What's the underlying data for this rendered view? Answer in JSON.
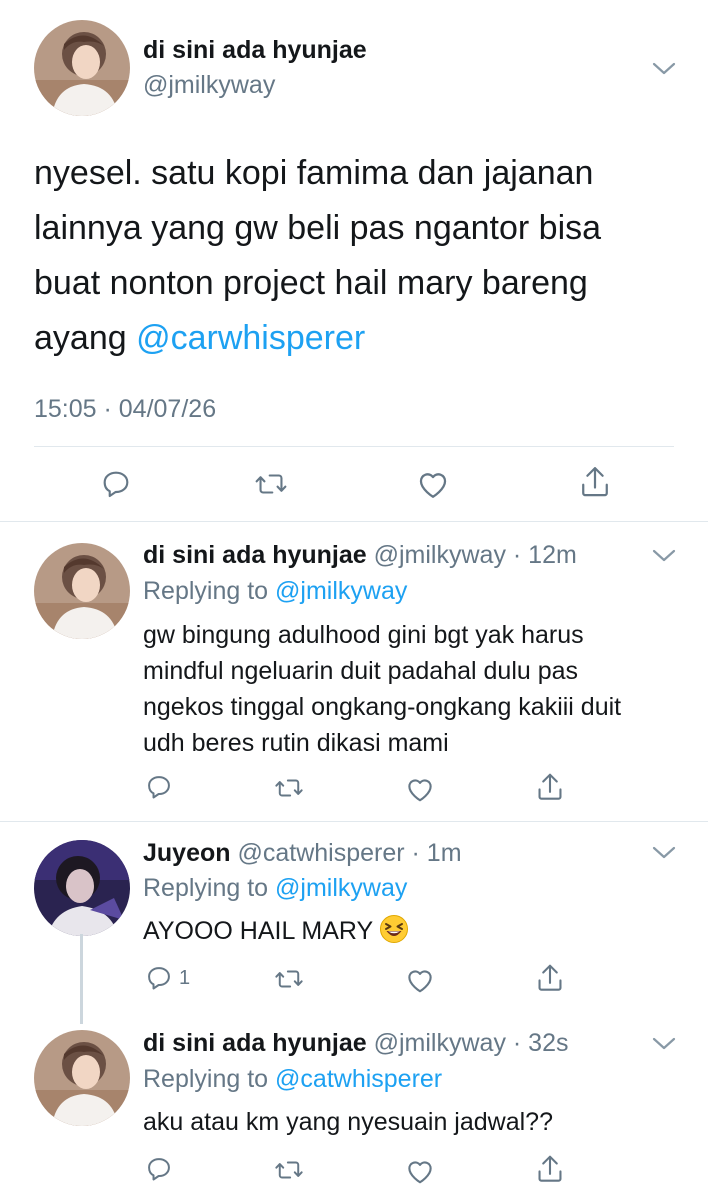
{
  "main_tweet": {
    "display_name": "di sini ada hyunjae",
    "handle": "@jmilkyway",
    "text": "nyesel. satu kopi famima dan jajanan lainnya yang gw beli pas ngantor bisa buat nonton project hail mary bareng ayang ",
    "mention": "@carwhisperer",
    "timestamp": "15:05 · 04/07/26",
    "avatar_icon": "profile-photo-hyunjae"
  },
  "replies": [
    {
      "display_name": "di sini ada hyunjae",
      "meta": "@jmilkyway · 12m",
      "replying_label": "Replying to ",
      "replying_to": "@jmilkyway",
      "text": "gw bingung adulhood gini bgt yak harus mindful ngeluarin duit padahal dulu pas ngekos tinggal ongkang-ongkang kakiii duit udh beres rutin dikasi mami",
      "reply_count": ""
    },
    {
      "display_name": "Juyeon",
      "meta": "@catwhisperer · 1m",
      "replying_label": "Replying to ",
      "replying_to": "@jmilkyway",
      "text": "AYOOO HAIL MARY",
      "emoji": "grinning-squinting-face",
      "reply_count": "1"
    },
    {
      "display_name": "di sini ada hyunjae",
      "meta": "@jmilkyway · 32s",
      "replying_label": "Replying to ",
      "replying_to": "@catwhisperer",
      "text": "aku atau km yang nyesuain jadwal??",
      "reply_count": ""
    }
  ],
  "icons": [
    "reply-icon",
    "retweet-icon",
    "like-icon",
    "share-icon",
    "chevron-down-icon"
  ],
  "colors": {
    "link": "#1da1f2",
    "secondary": "#657786",
    "divider": "#e1e8ed"
  }
}
